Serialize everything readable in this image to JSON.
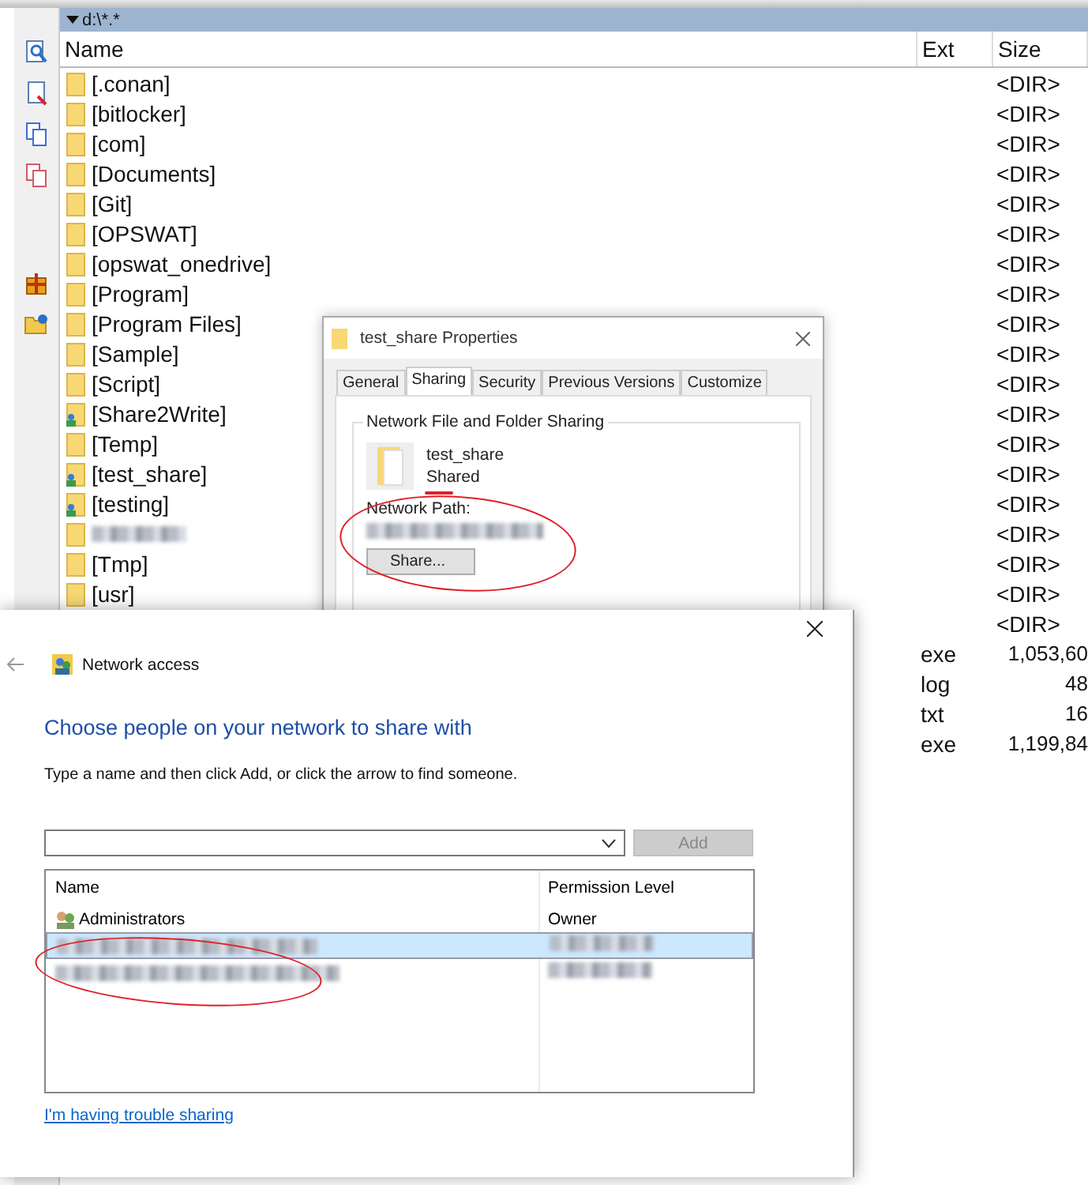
{
  "file_panel": {
    "path": "d:\\*.*",
    "columns": [
      "Name",
      "Ext",
      "Size"
    ],
    "rows": [
      {
        "kind": "folder",
        "name": "[.conan]",
        "shared": false,
        "size": "<DIR>"
      },
      {
        "kind": "folder",
        "name": "[bitlocker]",
        "shared": false,
        "size": "<DIR>"
      },
      {
        "kind": "folder",
        "name": "[com]",
        "shared": false,
        "size": "<DIR>"
      },
      {
        "kind": "folder",
        "name": "[Documents]",
        "shared": false,
        "size": "<DIR>"
      },
      {
        "kind": "folder",
        "name": "[Git]",
        "shared": false,
        "size": "<DIR>"
      },
      {
        "kind": "folder",
        "name": "[OPSWAT]",
        "shared": false,
        "size": "<DIR>"
      },
      {
        "kind": "folder",
        "name": "[opswat_onedrive]",
        "shared": false,
        "size": "<DIR>"
      },
      {
        "kind": "folder",
        "name": "[Program]",
        "shared": false,
        "size": "<DIR>"
      },
      {
        "kind": "folder",
        "name": "[Program Files]",
        "shared": false,
        "size": "<DIR>"
      },
      {
        "kind": "folder",
        "name": "[Sample]",
        "shared": false,
        "size": "<DIR>"
      },
      {
        "kind": "folder",
        "name": "[Script]",
        "shared": false,
        "size": "<DIR>"
      },
      {
        "kind": "folder",
        "name": "[Share2Write]",
        "shared": true,
        "size": "<DIR>"
      },
      {
        "kind": "folder",
        "name": "[Temp]",
        "shared": false,
        "size": "<DIR>"
      },
      {
        "kind": "folder",
        "name": "[test_share]",
        "shared": true,
        "size": "<DIR>"
      },
      {
        "kind": "folder",
        "name": "[testing]",
        "shared": true,
        "size": "<DIR>"
      },
      {
        "kind": "folder",
        "name_blurred": true,
        "shared": false,
        "size": "<DIR>"
      },
      {
        "kind": "folder",
        "name": "[Tmp]",
        "shared": false,
        "size": "<DIR>"
      },
      {
        "kind": "folder",
        "name": "[usr]",
        "shared": false,
        "size": "<DIR>"
      },
      {
        "kind": "hidden",
        "size": "<DIR>"
      },
      {
        "kind": "hidden",
        "ext": "exe",
        "size": "1,053,60"
      },
      {
        "kind": "hidden",
        "ext": "log",
        "size": "48"
      },
      {
        "kind": "hidden",
        "ext": "txt",
        "size": "16"
      },
      {
        "kind": "hidden",
        "ext": "exe",
        "size": "1,199,84"
      }
    ]
  },
  "properties_dialog": {
    "title": "test_share Properties",
    "tabs": [
      {
        "label": "General",
        "selected": false
      },
      {
        "label": "Sharing",
        "selected": true
      },
      {
        "label": "Security",
        "selected": false
      },
      {
        "label": "Previous Versions",
        "selected": false
      },
      {
        "label": "Customize",
        "selected": false
      }
    ],
    "group_title": "Network File and Folder Sharing",
    "folder_name": "test_share",
    "status": "Shared",
    "network_path_label": "Network Path:",
    "network_path_blurred": true,
    "share_button": "Share...",
    "markup": [
      {
        "kind": "underline"
      },
      {
        "kind": "ellipse"
      }
    ]
  },
  "network_dialog": {
    "title": "Network access",
    "heading": "Choose people on your network to share with",
    "instruction": "Type a name and then click Add, or click the arrow to find someone.",
    "add_button": {
      "label": "Add",
      "disabled": true
    },
    "columns": [
      "Name",
      "Permission Level"
    ],
    "rows": [
      {
        "name": "Administrators",
        "permission": "Owner",
        "selected": false
      },
      {
        "blurred": true,
        "selected": true
      },
      {
        "blurred": true,
        "selected": false
      }
    ],
    "link": "I'm having trouble sharing",
    "markup": [
      {
        "kind": "ellipse"
      }
    ]
  }
}
